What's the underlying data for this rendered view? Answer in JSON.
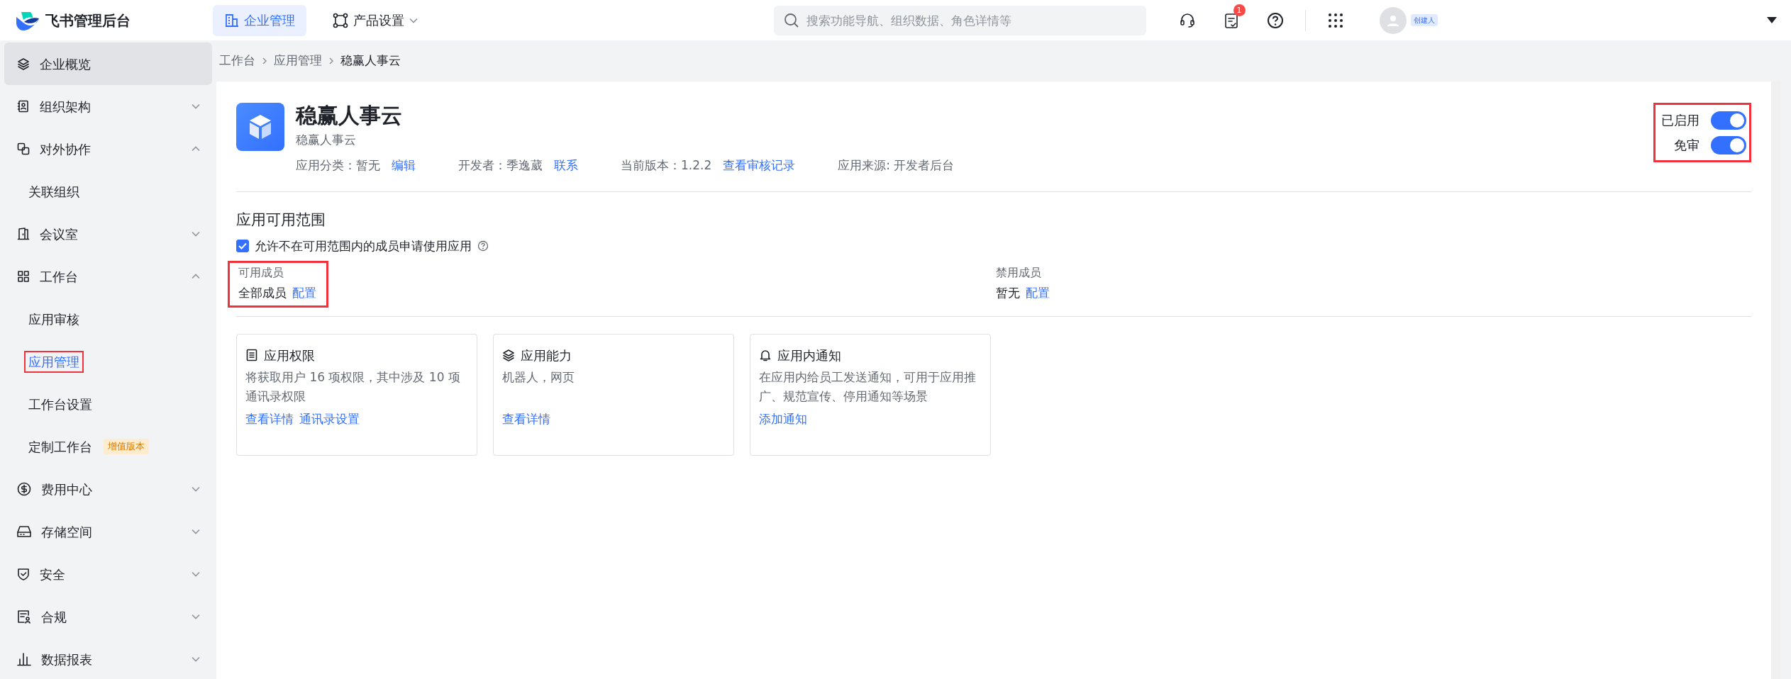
{
  "brand": {
    "name": "飞书管理后台"
  },
  "top_nav": [
    {
      "label": "企业管理",
      "selected": true
    },
    {
      "label": "产品设置",
      "selected": false,
      "dropdown": true
    }
  ],
  "search": {
    "placeholder": "搜索功能导航、组织数据、角色详情等"
  },
  "toolbar": {
    "notification_count": "1"
  },
  "user": {
    "role_badge": "创建人"
  },
  "sidebar": {
    "items": [
      {
        "label": "企业概览",
        "selected": true
      },
      {
        "label": "组织架构",
        "selected": false,
        "expanded": false
      },
      {
        "label": "对外协作",
        "selected": false,
        "expanded": true,
        "children": [
          {
            "label": "关联组织",
            "selected": false,
            "highlighted": false
          }
        ]
      },
      {
        "label": "会议室",
        "selected": false,
        "expanded": false
      },
      {
        "label": "工作台",
        "selected": false,
        "expanded": true,
        "children": [
          {
            "label": "应用审核",
            "selected": false,
            "highlighted": false
          },
          {
            "label": "应用管理",
            "selected": true,
            "highlighted": true
          },
          {
            "label": "工作台设置",
            "selected": false,
            "highlighted": false
          },
          {
            "label": "定制工作台",
            "selected": false,
            "highlighted": false,
            "badge": "增值版本"
          }
        ]
      },
      {
        "label": "费用中心",
        "selected": false,
        "expanded": false
      },
      {
        "label": "存储空间",
        "selected": false,
        "expanded": false
      },
      {
        "label": "安全",
        "selected": false,
        "expanded": false
      },
      {
        "label": "合规",
        "selected": false,
        "expanded": false
      },
      {
        "label": "数据报表",
        "selected": false,
        "expanded": false
      }
    ]
  },
  "breadcrumb": [
    {
      "label": "工作台",
      "selected": false
    },
    {
      "label": "应用管理",
      "selected": false
    },
    {
      "label": "稳赢人事云",
      "selected": true
    }
  ],
  "app": {
    "name": "稳赢人事云",
    "subtitle": "稳赢人事云",
    "meta": [
      {
        "text": "应用分类：暂无",
        "link": "编辑"
      },
      {
        "text": "开发者：季逸葳",
        "link": "联系"
      },
      {
        "text": "当前版本：1.2.2",
        "link": "查看审核记录"
      },
      {
        "text": "应用来源: 开发者后台"
      }
    ]
  },
  "switches": {
    "highlighted": true,
    "items": [
      {
        "label": "已启用",
        "on": true
      },
      {
        "label": "免审",
        "on": true
      }
    ]
  },
  "scope": {
    "title": "应用可用范围",
    "allow_request": {
      "label": "允许不在可用范围内的成员申请使用应用",
      "checked": true
    },
    "panels": [
      {
        "label": "可用成员",
        "value": "全部成员",
        "link": "配置",
        "highlighted": true
      },
      {
        "label": "禁用成员",
        "value": "暂无",
        "link": "配置",
        "highlighted": false
      }
    ]
  },
  "cards": [
    {
      "title": "应用权限",
      "description": "将获取用户 16 项权限，其中涉及 10 项通讯录权限",
      "links": [
        "查看详情",
        "通讯录设置"
      ]
    },
    {
      "title": "应用能力",
      "description": "机器人，网页",
      "links": [
        "查看详情"
      ]
    },
    {
      "title": "应用内通知",
      "description": "在应用内给员工发送通知，可用于应用推广、规范宣传、停用通知等场景",
      "links": [
        "添加通知"
      ]
    }
  ]
}
